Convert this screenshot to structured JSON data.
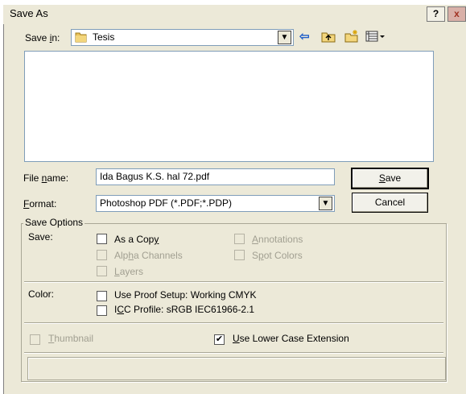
{
  "window": {
    "title": "Save As",
    "help_label": "?",
    "close_label": "x"
  },
  "save_in": {
    "label_pre": "Save ",
    "label_key": "i",
    "label_post": "n:",
    "value": "Tesis"
  },
  "toolbar": {
    "back_icon": "⇦",
    "up_icon": "⤒",
    "new_folder_icon": "✶",
    "view_icon": "▦▾"
  },
  "file_name": {
    "label_pre": "File ",
    "label_key": "n",
    "label_post": "ame:",
    "value": "Ida Bagus K.S. hal 72.pdf"
  },
  "format": {
    "label_key": "F",
    "label_post": "ormat:",
    "value": "Photoshop PDF (*.PDF;*.PDP)"
  },
  "buttons": {
    "save_key": "S",
    "save_post": "ave",
    "cancel": "Cancel"
  },
  "save_options": {
    "title": "Save Options",
    "save_label": "Save:",
    "as_a_copy": {
      "pre": "As a Cop",
      "key": "y",
      "post": "",
      "checked": false,
      "enabled": true
    },
    "alpha_channels": {
      "pre": "Alp",
      "key": "h",
      "post": "a Channels",
      "checked": false,
      "enabled": false
    },
    "layers": {
      "pre": "",
      "key": "L",
      "post": "ayers",
      "checked": false,
      "enabled": false
    },
    "annotations": {
      "pre": "",
      "key": "A",
      "post": "nnotations",
      "checked": false,
      "enabled": false
    },
    "spot_colors": {
      "pre": "S",
      "key": "p",
      "post": "ot Colors",
      "checked": false,
      "enabled": false
    },
    "color_label": "Color:",
    "use_proof_setup": {
      "text": "Use Proof Setup:  Working CMYK",
      "checked": false,
      "enabled": true
    },
    "icc_profile": {
      "pre": "I",
      "key": "C",
      "post": "C Profile:  sRGB IEC61966-2.1",
      "checked": false,
      "enabled": true
    },
    "thumbnail": {
      "pre": "",
      "key": "T",
      "post": "humbnail",
      "checked": false,
      "enabled": false
    },
    "lower_case_ext": {
      "pre": "",
      "key": "U",
      "post": "se Lower Case Extension",
      "checked": true,
      "enabled": true
    }
  }
}
